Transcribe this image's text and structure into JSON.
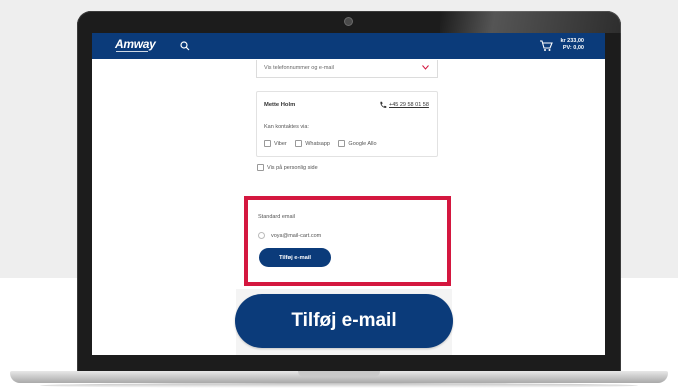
{
  "navbar": {
    "logo": "Amway",
    "cart_amount": "kr 233,00",
    "cart_pv": "PV: 0,00"
  },
  "form": {
    "select_placeholder": "Vis telefonnummer og e-mail",
    "contact": {
      "name": "Mette Holm",
      "phone": "+45 29 58 01 58",
      "contact_via_label": "Kan kontaktes via:",
      "options": [
        "Viber",
        "Whatsapp",
        "Google Allo"
      ]
    },
    "show_personal": "Vis på personlig side",
    "standard_email_label": "Standard email",
    "email_value": "voya@mail-cart.com",
    "add_email_small": "Tilføj e-mail"
  },
  "zoom_button": {
    "label": "Tilføj e-mail"
  },
  "colors": {
    "navy": "#0b3b7a",
    "highlight_red": "#d4173f"
  }
}
